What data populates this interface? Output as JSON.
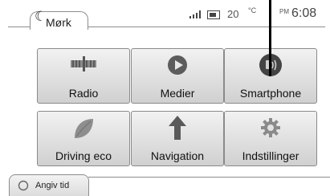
{
  "header": {
    "mode_label": "Mørk"
  },
  "status": {
    "temperature": "20",
    "temp_unit": "°C",
    "ampm": "PM",
    "time": "6:08"
  },
  "tiles": [
    {
      "label": "Radio",
      "icon": "radio-icon"
    },
    {
      "label": "Medier",
      "icon": "media-play-icon"
    },
    {
      "label": "Smartphone",
      "icon": "smartphone-icon"
    },
    {
      "label": "Driving eco",
      "icon": "eco-leaf-icon"
    },
    {
      "label": "Navigation",
      "icon": "navigation-arrow-icon"
    },
    {
      "label": "Indstillinger",
      "icon": "gear-icon"
    }
  ],
  "footer": {
    "time_button_label": "Angiv tid"
  }
}
